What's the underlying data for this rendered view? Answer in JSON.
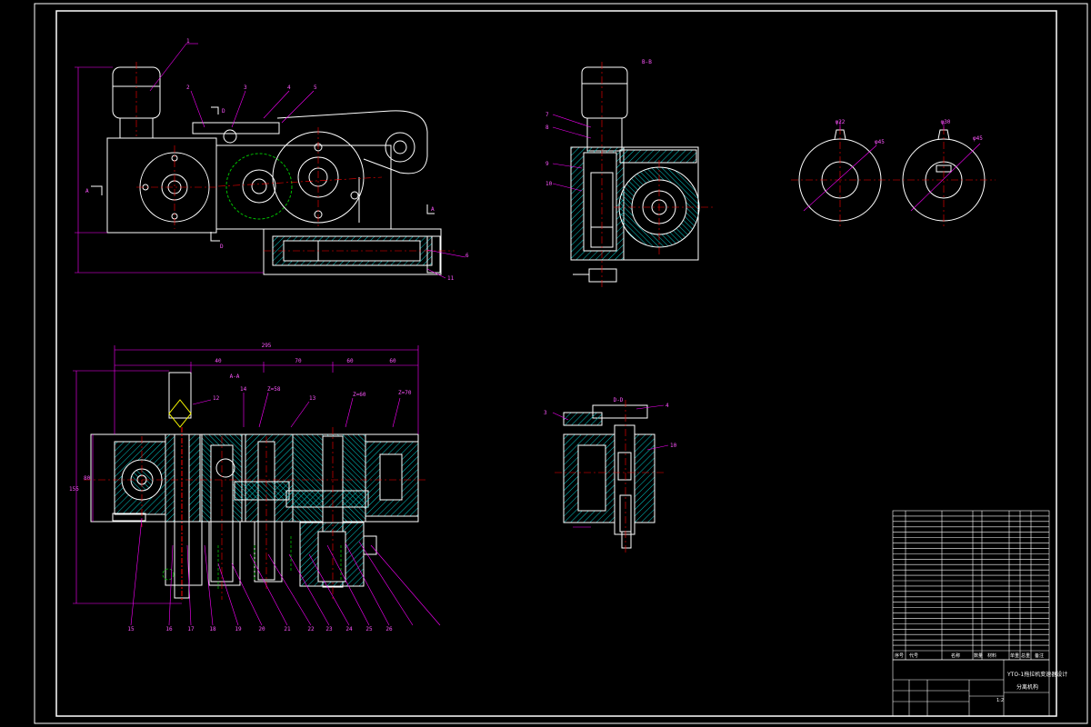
{
  "drawing": {
    "sheet": {
      "border_color": "#ffffff",
      "line_color": "#ffffff",
      "dim_color": "#ff00ff",
      "center_color": "#ff0000",
      "hatch_color": "#00c8c8",
      "gear_color": "#00c000"
    },
    "views": {
      "front": {
        "balloons": [
          "1",
          "2",
          "3",
          "4",
          "5",
          "6",
          "11"
        ],
        "section_marks": [
          "A",
          "A",
          "D",
          "D"
        ]
      },
      "side": {
        "title": "B-B",
        "balloons": [
          "7",
          "8",
          "9",
          "10"
        ]
      },
      "detail_gears": {
        "dims": [
          "φ22",
          "φ30",
          "φ45",
          "φ45"
        ]
      },
      "section_aa": {
        "title": "A-A",
        "overall_dim": "295",
        "top_dims": [
          "40",
          "70",
          "60",
          "60"
        ],
        "left_dims": [
          "80",
          "155"
        ],
        "gear_notes": [
          "Z=58",
          "Z=60",
          "Z=70"
        ],
        "balloons": [
          "12",
          "13",
          "14",
          "15",
          "16",
          "17",
          "18",
          "19",
          "20",
          "21",
          "22",
          "23",
          "24",
          "25",
          "26"
        ]
      },
      "section_dd": {
        "title": "D-D",
        "balloons": [
          "3",
          "4",
          "10"
        ]
      }
    },
    "title_block": {
      "rows": 26,
      "header": [
        "序号",
        "代号",
        "名称",
        "数量",
        "材料",
        "单重",
        "总重",
        "备注"
      ],
      "title": "YTO-1拖拉机变速器设计",
      "subtitle": "分离机构",
      "scale": "1:2"
    }
  }
}
